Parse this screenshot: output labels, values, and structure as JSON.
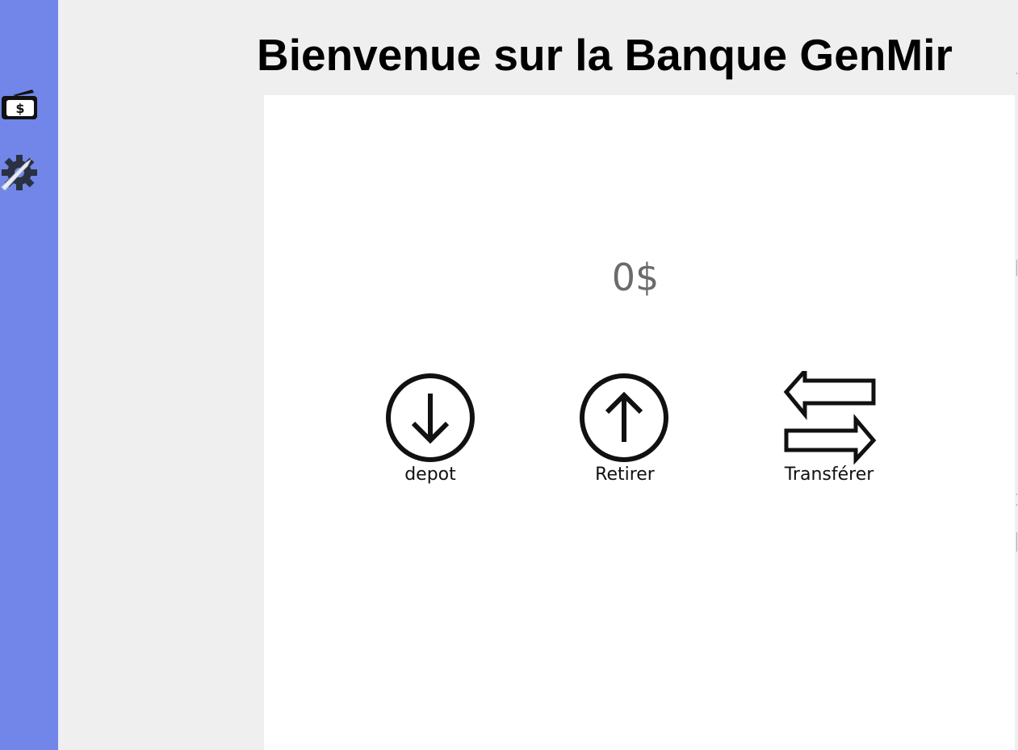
{
  "header": {
    "title": "Bienvenue sur la Banque GenMir"
  },
  "sidebar": {
    "items": [
      {
        "icon": "wallet-dollar-icon"
      },
      {
        "icon": "settings-wrench-gear-icon"
      }
    ]
  },
  "account": {
    "balance": "0$"
  },
  "actions": {
    "deposit_label": "depot",
    "withdraw_label": "Retirer",
    "transfer_label": "Transférer"
  },
  "colors": {
    "sidebar": "#7186e8",
    "background": "#efefef",
    "panel": "#ffffff",
    "balance_text": "#6b6b6b"
  }
}
